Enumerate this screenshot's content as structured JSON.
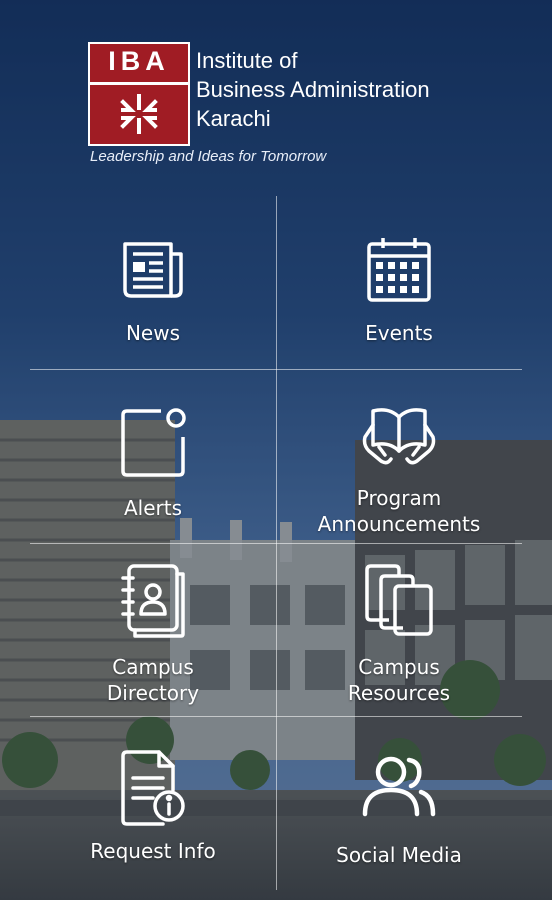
{
  "header": {
    "logo_text": "IBA",
    "institute_lines": [
      "Institute of",
      "Business Administration",
      "Karachi"
    ],
    "tagline": "Leadership and Ideas for Tomorrow"
  },
  "tiles": [
    {
      "label_lines": [
        "News"
      ],
      "icon": "newspaper-icon"
    },
    {
      "label_lines": [
        "Events"
      ],
      "icon": "calendar-icon"
    },
    {
      "label_lines": [
        "Alerts"
      ],
      "icon": "alert-notification-icon"
    },
    {
      "label_lines": [
        "Program",
        "Announcements"
      ],
      "icon": "open-book-icon"
    },
    {
      "label_lines": [
        "Campus",
        "Directory"
      ],
      "icon": "contact-directory-icon"
    },
    {
      "label_lines": [
        "Campus",
        "Resources"
      ],
      "icon": "stacked-documents-icon"
    },
    {
      "label_lines": [
        "Request Info"
      ],
      "icon": "document-info-icon"
    },
    {
      "label_lines": [
        "Social Media"
      ],
      "icon": "people-icon"
    }
  ],
  "colors": {
    "brand_red": "#a01c24",
    "sky_top": "#173566",
    "sky_bottom": "#5d83b6",
    "text": "#ffffff"
  }
}
